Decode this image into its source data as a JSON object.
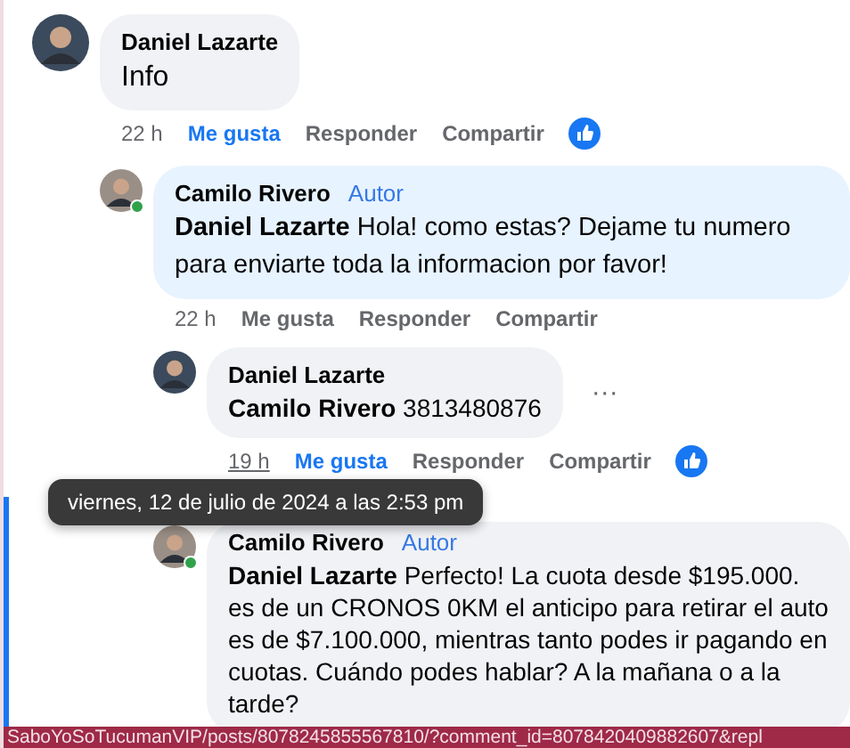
{
  "comments": [
    {
      "author": "Daniel Lazarte",
      "text": "Info",
      "time": "22 h",
      "time_hovered": false,
      "actions": [
        "Me gusta",
        "Responder",
        "Compartir"
      ],
      "liked": true,
      "reacted": true,
      "highlighted": false,
      "online": false,
      "children": [
        {
          "author": "Camilo Rivero",
          "badge": "Autor",
          "mention": "Daniel Lazarte",
          "text": "Hola! como estas? Dejame tu numero para enviarte toda la informacion por favor!",
          "time": "22 h",
          "time_hovered": false,
          "actions": [
            "Me gusta",
            "Responder",
            "Compartir"
          ],
          "liked": false,
          "reacted": false,
          "highlighted": false,
          "online": true,
          "children": [
            {
              "author": "Daniel Lazarte",
              "mention": "Camilo Rivero",
              "text": "3813480876",
              "more": "···",
              "time": "19 h",
              "time_hovered": true,
              "actions": [
                "Me gusta",
                "Responder",
                "Compartir"
              ],
              "liked": true,
              "reacted": true,
              "highlighted": false,
              "online": false
            },
            {
              "author": "Camilo Rivero",
              "badge": "Autor",
              "mention": "Daniel Lazarte",
              "text": "Perfecto! La cuota desde $195.000. es de un CRONOS 0KM el anticipo para retirar el auto es de $7.100.000, mientras tanto podes ir pagando en cuotas. Cuándo podes hablar? A la mañana o a la tarde?",
              "highlighted": true,
              "online": true
            }
          ]
        }
      ]
    }
  ],
  "tooltip": "viernes, 12 de julio de 2024 a las 2:53 pm",
  "status_bar": "SaboYoSoTucumanVIP/posts/8078245855567810/?comment_id=8078420409882607&repl"
}
